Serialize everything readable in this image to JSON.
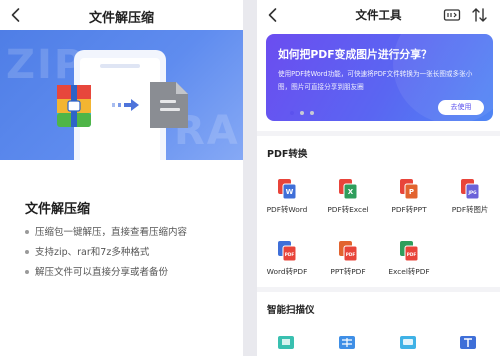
{
  "left": {
    "title": "文件解压缩",
    "hero_bg": [
      "ZIP",
      "RAR"
    ],
    "heading": "文件解压缩",
    "bullets": [
      "压缩包一键解压，直接查看压缩内容",
      "支持zip、rar和7z多种格式",
      "解压文件可以直接分享或者备份"
    ]
  },
  "right": {
    "title": "文件工具",
    "banner": {
      "title": "如何把PDF变成图片进行分享？",
      "desc": "使用PDF转Word功能，可快速将PDF文件转换为一张长图或多张小图，图片可直接分享到朋友圈",
      "button": "去使用",
      "slides": 3,
      "active_slide": 0
    },
    "pdf_section": {
      "title": "PDF转换",
      "tools": [
        {
          "label": "PDF转Word",
          "icon": "word-icon",
          "badge": "W",
          "color": "#3f6fd8"
        },
        {
          "label": "PDF转Excel",
          "icon": "excel-icon",
          "badge": "X",
          "color": "#2f9e5c"
        },
        {
          "label": "PDF转PPT",
          "icon": "ppt-icon",
          "badge": "P",
          "color": "#e2632f"
        },
        {
          "label": "PDF转图片",
          "icon": "image-icon",
          "badge": "JPG",
          "color": "#6a62d9"
        },
        {
          "label": "Word转PDF",
          "icon": "word-to-pdf-icon",
          "badge": "W",
          "color": "#3f6fd8"
        },
        {
          "label": "PPT转PDF",
          "icon": "ppt-to-pdf-icon",
          "badge": "P",
          "color": "#e2632f"
        },
        {
          "label": "Excel转PDF",
          "icon": "excel-to-pdf-icon",
          "badge": "X",
          "color": "#2f9e5c"
        }
      ]
    },
    "scan_section": {
      "title": "智能扫描仪"
    }
  },
  "colors": {
    "accent": "#5b52ee",
    "pdf_red": "#e8443a",
    "hero_blue": "#5a88ee"
  }
}
